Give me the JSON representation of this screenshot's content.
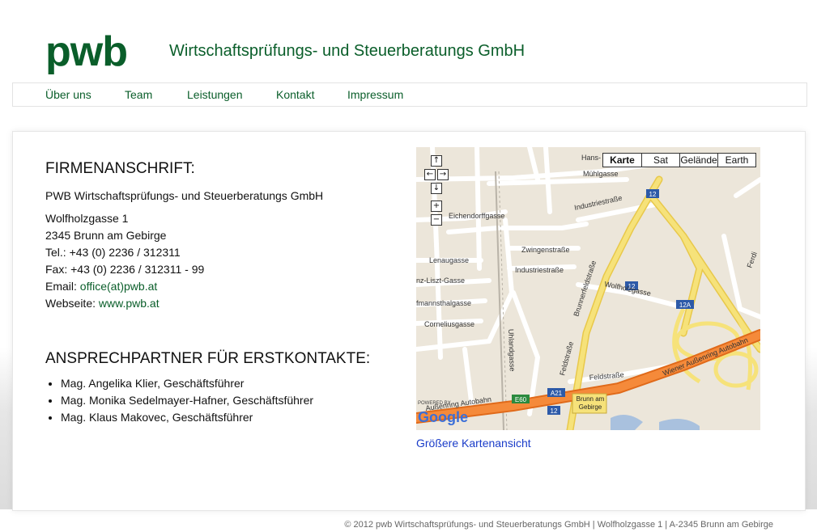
{
  "header": {
    "logo_text": "pwb",
    "company_name": "Wirtschaftsprüfungs- und Steuerberatungs GmbH"
  },
  "nav": {
    "items": [
      {
        "label": "Über uns"
      },
      {
        "label": "Team"
      },
      {
        "label": "Leistungen"
      },
      {
        "label": "Kontakt"
      },
      {
        "label": "Impressum"
      }
    ]
  },
  "address": {
    "heading": "FIRMENANSCHRIFT:",
    "company": "PWB Wirtschaftsprüfungs- und Steuerberatungs GmbH",
    "street": "Wolfholzgasse 1",
    "city": "2345 Brunn am Gebirge",
    "tel": "Tel.: +43 (0) 2236 / 312311",
    "fax": "Fax: +43 (0) 2236 / 312311 - 99",
    "email_label": "Email: ",
    "email": "office(at)pwb.at",
    "web_label": "Webseite: ",
    "web": "www.pwb.at"
  },
  "contacts": {
    "heading": "ANSPRECHPARTNER FÜR ERSTKONTAKTE:",
    "people": [
      "Mag. Angelika Klier, Geschäftsführer",
      "Mag. Monika Sedelmayer-Hafner, Geschäftsführer",
      "Mag. Klaus Makovec, Geschäftsführer"
    ]
  },
  "map": {
    "types": [
      "Karte",
      "Sat",
      "Gelände",
      "Earth"
    ],
    "streets": {
      "muehlgasse": "Mühlgasse",
      "hans": "Hans-",
      "industriestrasse1": "Industriestraße",
      "eichendorffgasse": "Eichendorffgasse",
      "zwingenstrasse": "Zwingenstraße",
      "industriestrasse2": "Industriestraße",
      "lenaugasse": "Lenaugasse",
      "lisztgasse": "nz-Liszt-Gasse",
      "hofmannsthalgasse": "fmannsthalgasse",
      "corneliusgasse": "Corneliusgasse",
      "wolfholzgasse": "Wolfholzgasse",
      "brunnerfeldstrasse": "Brunnerfeldstraße",
      "uhlandgasse": "Uhlandgasse",
      "feldstrasse1": "Feldstraße",
      "feldstrasse2": "Feldstraße",
      "autobahn1": "Wiener Außenring Autobahn",
      "autobahn2": "Außenring Autobahn",
      "brunn": "Brunn am Gebirge",
      "ferd": "Ferdi"
    },
    "shields": [
      "12",
      "12",
      "12A",
      "A21",
      "E60",
      "12"
    ],
    "powered": "POWERED BY",
    "google": "Google",
    "link": "Größere Kartenansicht"
  },
  "footer": {
    "text": "© 2012 pwb Wirtschaftsprüfungs- und Steuerberatungs GmbH | Wolfholzgasse 1 | A-2345 Brunn am Gebirge"
  },
  "colors": {
    "brand_green": "#0a5e2a",
    "link_blue": "#1a3cc9",
    "highway_yellow": "#f6e27a",
    "autobahn_orange": "#f58a3a"
  }
}
